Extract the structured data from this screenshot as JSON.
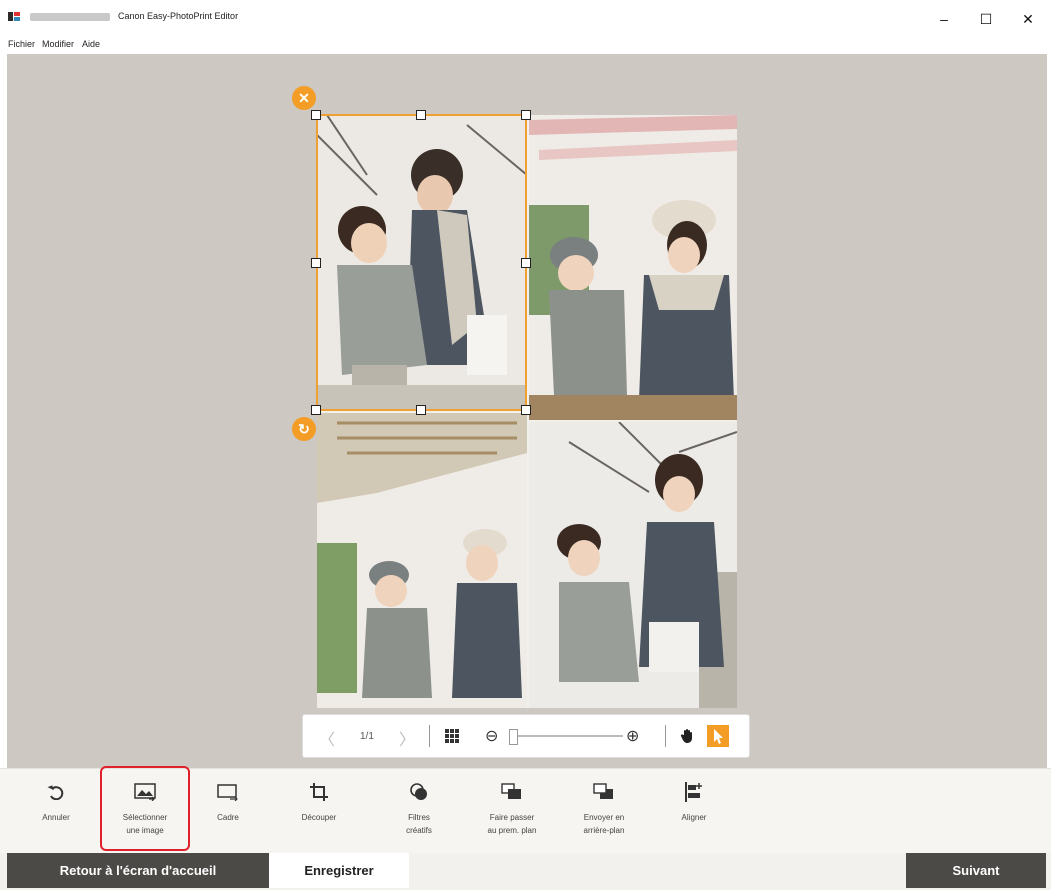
{
  "window": {
    "title": "Canon Easy-PhotoPrint Editor",
    "minimize": "–",
    "maximize": "☐",
    "close": "✕"
  },
  "menu": [
    "Fichier",
    "Modifier",
    "Aide"
  ],
  "selection": {
    "delete_glyph": "✕",
    "rotate_glyph": "↻"
  },
  "pager": {
    "prev": "〈",
    "page": "1/1",
    "next": "〉",
    "zoom_out": "⊖",
    "zoom_in": "⊕",
    "zoom_level": 0
  },
  "toolbar": {
    "undo": "Annuler",
    "select_image_1": "Sélectionner",
    "select_image_2": "une image",
    "frame": "Cadre",
    "crop": "Découper",
    "filters_1": "Filtres",
    "filters_2": "créatifs",
    "front_1": "Faire passer",
    "front_2": "au prem. plan",
    "back_1": "Envoyer en",
    "back_2": "arrière-plan",
    "align": "Aligner"
  },
  "footer": {
    "home": "Retour à l'écran d'accueil",
    "save": "Enregistrer",
    "next": "Suivant"
  },
  "colors": {
    "accent": "#f39c26",
    "highlight": "#e0212b",
    "canvas": "#cdc9c2",
    "dark_button": "#4c4a47"
  }
}
